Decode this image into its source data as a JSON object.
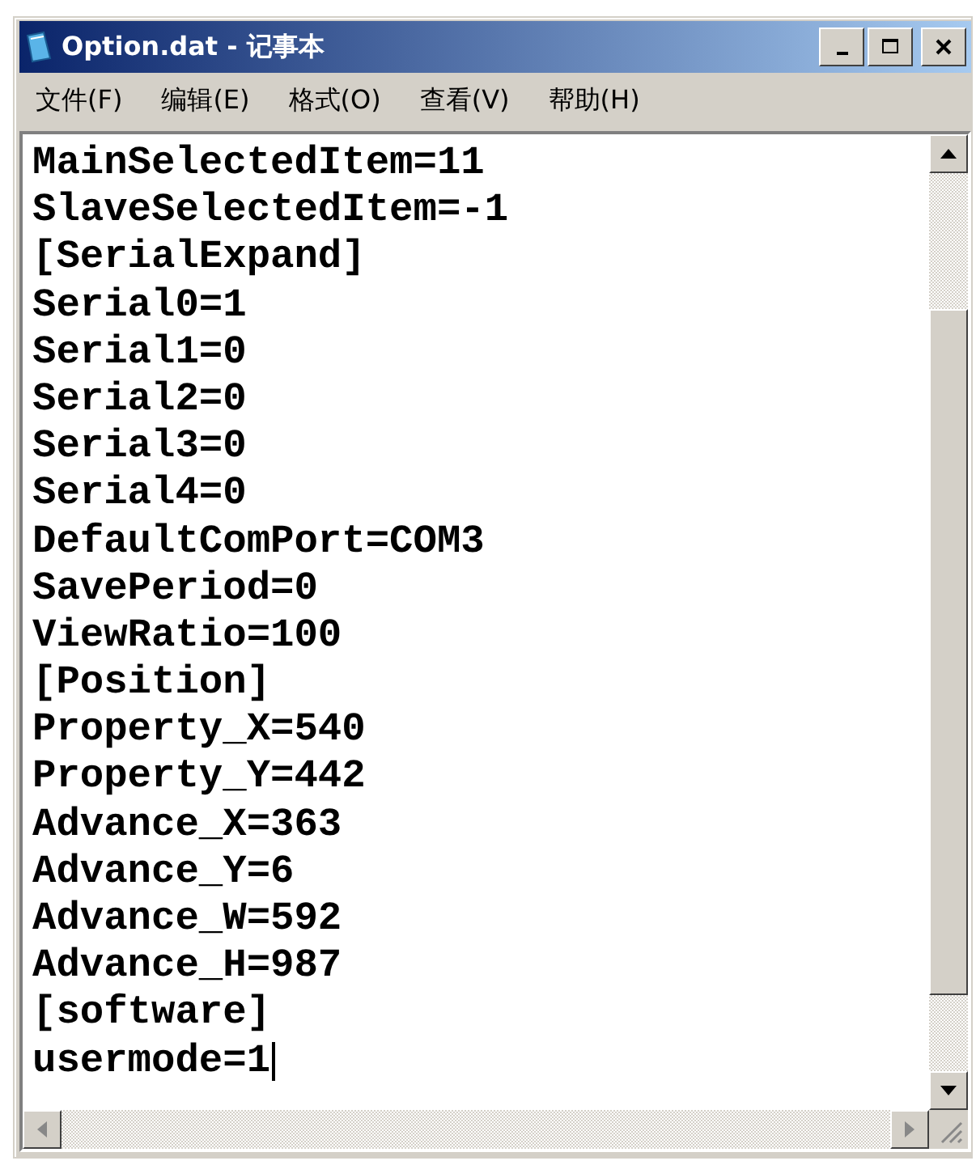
{
  "window": {
    "title": "Option.dat - 记事本"
  },
  "menu": [
    "文件(F)",
    "编辑(E)",
    "格式(O)",
    "查看(V)",
    "帮助(H)"
  ],
  "lines": [
    "MainSelectedItem=11",
    "SlaveSelectedItem=-1",
    "[SerialExpand]",
    "Serial0=1",
    "Serial1=0",
    "Serial2=0",
    "Serial3=0",
    "Serial4=0",
    "DefaultComPort=COM3",
    "SavePeriod=0",
    "ViewRatio=100",
    "[Position]",
    "Property_X=540",
    "Property_Y=442",
    "Advance_X=363",
    "Advance_Y=6",
    "Advance_W=592",
    "Advance_H=987",
    "[software]",
    "usermode=1"
  ]
}
